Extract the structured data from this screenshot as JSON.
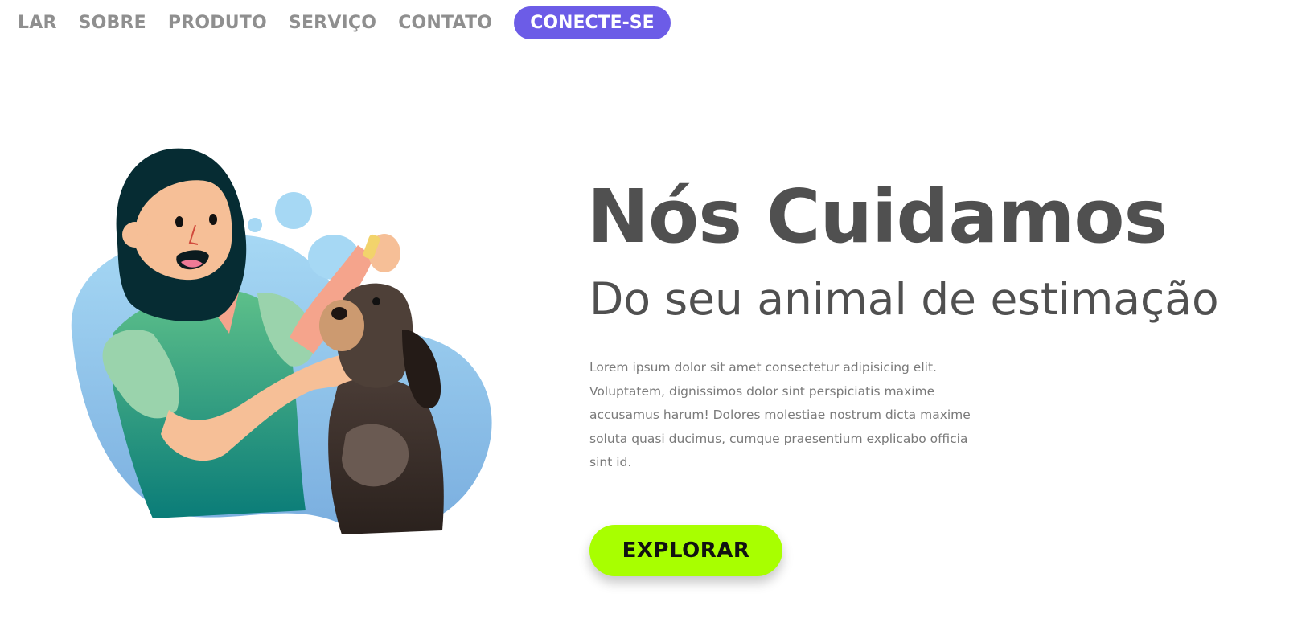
{
  "nav": {
    "links": [
      "LAR",
      "SOBRE",
      "PRODUTO",
      "SERVIÇO",
      "CONTATO"
    ],
    "cta_label": "CONECTE-SE"
  },
  "hero": {
    "title": "Nós Cuidamos",
    "subtitle": "Do seu animal de estimação",
    "body": "Lorem ipsum dolor sit amet consectetur adipisicing elit. Voluptatem, dignissimos dolor sint perspiciatis maxime accusamus harum! Dolores molestiae nostrum dicta maxime soluta quasi ducimus, cumque praesentium explicabo officia sint id.",
    "button_label": "EXPLORAR"
  },
  "colors": {
    "accent": "#6c5ce7",
    "button": "#a8ff00",
    "heading": "#505050",
    "body_text": "#7a7a7a",
    "nav_text": "#8f8f8f"
  },
  "illustration": {
    "icon": "vet-with-dog-illustration"
  }
}
